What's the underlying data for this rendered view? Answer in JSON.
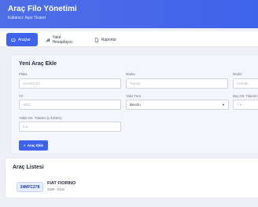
{
  "header": {
    "title": "Araç Filo Yönetimi",
    "subtitle": "Kullanıcı: Ayor Ticarst"
  },
  "tabs": [
    {
      "label": "Araçlar",
      "icon": "car-icon",
      "active": true
    },
    {
      "label": "Yakıt Hesaplayıcı",
      "icon": "chart-icon",
      "active": false
    },
    {
      "label": "Raporlar",
      "icon": "document-icon",
      "active": false
    }
  ],
  "form": {
    "title": "Yeni Araç Ekle",
    "plaka": {
      "label": "Plaka",
      "placeholder": "34ABC123"
    },
    "marka": {
      "label": "Marka",
      "placeholder": "Toyota"
    },
    "model": {
      "label": "Model",
      "placeholder": "Corolla"
    },
    "yil": {
      "label": "Yıl",
      "placeholder": "2022"
    },
    "yakit_turu": {
      "label": "Yakıt Türü",
      "value": "Benzin"
    },
    "boy_ort": {
      "label": "Boy Ort. Tüketim",
      "placeholder": "7.5"
    },
    "yukulu_ort": {
      "label": "Yüklü Ort. Tüketim (L/100km)",
      "placeholder": "9.5"
    },
    "add_button": "Araç Ekle"
  },
  "list": {
    "title": "Araç Listesi",
    "vehicles": [
      {
        "plate": "34MFC278",
        "name": "FIAT FIORINO",
        "meta": "2005 - Dizel"
      }
    ]
  },
  "colors": {
    "accent": "#3f63ea",
    "page_bg": "#eef0f5"
  }
}
